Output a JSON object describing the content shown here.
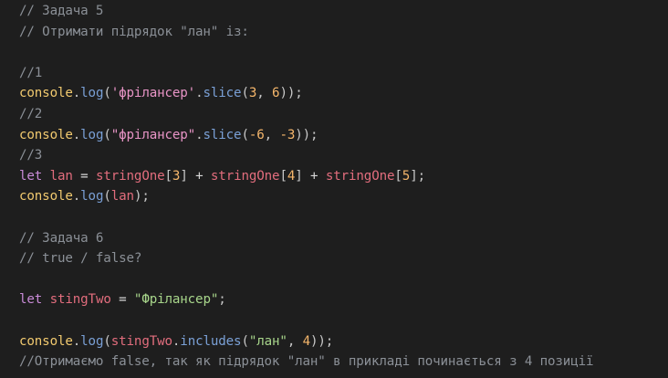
{
  "editor": {
    "lines": [
      {
        "tokens": [
          {
            "t": "// Задача 5",
            "c": "tok-comment"
          }
        ]
      },
      {
        "tokens": [
          {
            "t": "// Отримати підрядок \"лан\" із:",
            "c": "tok-comment"
          }
        ]
      },
      {
        "tokens": [
          {
            "t": "",
            "c": "tok-plain"
          }
        ]
      },
      {
        "tokens": [
          {
            "t": "//1",
            "c": "tok-comment"
          }
        ]
      },
      {
        "tokens": [
          {
            "t": "console",
            "c": "tok-console"
          },
          {
            "t": ".",
            "c": "tok-punc"
          },
          {
            "t": "log",
            "c": "tok-method"
          },
          {
            "t": "(",
            "c": "tok-punc"
          },
          {
            "t": "'фрілансер'",
            "c": "tok-string"
          },
          {
            "t": ".",
            "c": "tok-punc"
          },
          {
            "t": "slice",
            "c": "tok-method"
          },
          {
            "t": "(",
            "c": "tok-punc"
          },
          {
            "t": "3",
            "c": "tok-number"
          },
          {
            "t": ", ",
            "c": "tok-punc"
          },
          {
            "t": "6",
            "c": "tok-number"
          },
          {
            "t": "));",
            "c": "tok-punc"
          }
        ]
      },
      {
        "tokens": [
          {
            "t": "//2",
            "c": "tok-comment"
          }
        ]
      },
      {
        "tokens": [
          {
            "t": "console",
            "c": "tok-console"
          },
          {
            "t": ".",
            "c": "tok-punc"
          },
          {
            "t": "log",
            "c": "tok-method"
          },
          {
            "t": "(",
            "c": "tok-punc"
          },
          {
            "t": "\"фрілансер\"",
            "c": "tok-string"
          },
          {
            "t": ".",
            "c": "tok-punc"
          },
          {
            "t": "slice",
            "c": "tok-method"
          },
          {
            "t": "(",
            "c": "tok-punc"
          },
          {
            "t": "-6",
            "c": "tok-number"
          },
          {
            "t": ", ",
            "c": "tok-punc"
          },
          {
            "t": "-3",
            "c": "tok-number"
          },
          {
            "t": "));",
            "c": "tok-punc"
          }
        ]
      },
      {
        "tokens": [
          {
            "t": "//3",
            "c": "tok-comment"
          }
        ]
      },
      {
        "tokens": [
          {
            "t": "let",
            "c": "tok-keyword"
          },
          {
            "t": " ",
            "c": "tok-plain"
          },
          {
            "t": "lan",
            "c": "tok-var"
          },
          {
            "t": " = ",
            "c": "tok-op"
          },
          {
            "t": "stringOne",
            "c": "tok-var"
          },
          {
            "t": "[",
            "c": "tok-punc"
          },
          {
            "t": "3",
            "c": "tok-number"
          },
          {
            "t": "]",
            "c": "tok-punc"
          },
          {
            "t": " + ",
            "c": "tok-op"
          },
          {
            "t": "stringOne",
            "c": "tok-var"
          },
          {
            "t": "[",
            "c": "tok-punc"
          },
          {
            "t": "4",
            "c": "tok-number"
          },
          {
            "t": "]",
            "c": "tok-punc"
          },
          {
            "t": " + ",
            "c": "tok-op"
          },
          {
            "t": "stringOne",
            "c": "tok-var"
          },
          {
            "t": "[",
            "c": "tok-punc"
          },
          {
            "t": "5",
            "c": "tok-number"
          },
          {
            "t": "];",
            "c": "tok-punc"
          }
        ]
      },
      {
        "tokens": [
          {
            "t": "console",
            "c": "tok-console"
          },
          {
            "t": ".",
            "c": "tok-punc"
          },
          {
            "t": "log",
            "c": "tok-method"
          },
          {
            "t": "(",
            "c": "tok-punc"
          },
          {
            "t": "lan",
            "c": "tok-var"
          },
          {
            "t": ");",
            "c": "tok-punc"
          }
        ]
      },
      {
        "tokens": [
          {
            "t": "",
            "c": "tok-plain"
          }
        ]
      },
      {
        "tokens": [
          {
            "t": "// Задача 6",
            "c": "tok-comment"
          }
        ]
      },
      {
        "tokens": [
          {
            "t": "// true / false?",
            "c": "tok-comment"
          }
        ]
      },
      {
        "tokens": [
          {
            "t": "",
            "c": "tok-plain"
          }
        ]
      },
      {
        "tokens": [
          {
            "t": "let",
            "c": "tok-keyword"
          },
          {
            "t": " ",
            "c": "tok-plain"
          },
          {
            "t": "stingTwo",
            "c": "tok-var"
          },
          {
            "t": " = ",
            "c": "tok-op"
          },
          {
            "t": "\"Фрілансер\"",
            "c": "tok-string-green"
          },
          {
            "t": ";",
            "c": "tok-punc"
          }
        ]
      },
      {
        "tokens": [
          {
            "t": "",
            "c": "tok-plain"
          }
        ]
      },
      {
        "tokens": [
          {
            "t": "console",
            "c": "tok-console"
          },
          {
            "t": ".",
            "c": "tok-punc"
          },
          {
            "t": "log",
            "c": "tok-method"
          },
          {
            "t": "(",
            "c": "tok-punc"
          },
          {
            "t": "stingTwo",
            "c": "tok-var"
          },
          {
            "t": ".",
            "c": "tok-punc"
          },
          {
            "t": "includes",
            "c": "tok-method"
          },
          {
            "t": "(",
            "c": "tok-punc"
          },
          {
            "t": "\"лан\"",
            "c": "tok-string-green"
          },
          {
            "t": ", ",
            "c": "tok-punc"
          },
          {
            "t": "4",
            "c": "tok-number"
          },
          {
            "t": "));",
            "c": "tok-punc"
          }
        ]
      },
      {
        "tokens": [
          {
            "t": "//Отримаємо false, так як підрядок \"лан\" в прикладі починається з 4 позиції",
            "c": "tok-comment"
          }
        ]
      }
    ]
  },
  "colors": {
    "background": "#1e1e1e",
    "comment": "#8b9097",
    "console": "#f2ca6f",
    "method": "#7aa0d6",
    "string": "#e995c7",
    "string_green": "#a8d68b",
    "number": "#f5b66b",
    "keyword": "#c98bd8",
    "variable": "#e26d7d"
  }
}
